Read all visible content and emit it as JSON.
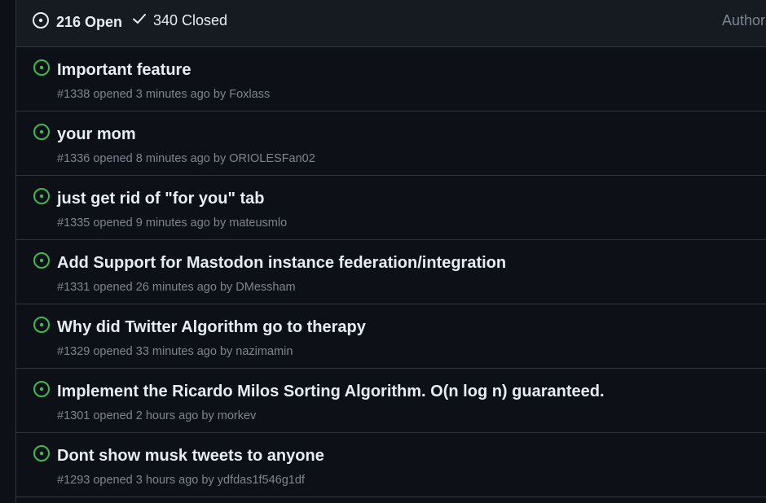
{
  "header": {
    "open_label": "216 Open",
    "closed_label": "340 Closed",
    "author_filter": "Author"
  },
  "colors": {
    "open_icon": "#3fb950",
    "background": "#0d1117",
    "header_bg": "#161b22",
    "muted_text": "#7d8590",
    "border": "#30363d"
  },
  "issues": [
    {
      "title": "Important feature",
      "number": "#1338",
      "opened": "opened 3 minutes ago by",
      "author": "Foxlass"
    },
    {
      "title": "your mom",
      "number": "#1336",
      "opened": "opened 8 minutes ago by",
      "author": "ORIOLESFan02"
    },
    {
      "title": "just get rid of \"for you\" tab",
      "number": "#1335",
      "opened": "opened 9 minutes ago by",
      "author": "mateusmlo"
    },
    {
      "title": "Add Support for Mastodon instance federation/integration",
      "number": "#1331",
      "opened": "opened 26 minutes ago by",
      "author": "DMessham"
    },
    {
      "title": "Why did Twitter Algorithm go to therapy",
      "number": "#1329",
      "opened": "opened 33 minutes ago by",
      "author": "nazimamin"
    },
    {
      "title": "Implement the Ricardo Milos Sorting Algorithm. O(n log n) guaranteed.",
      "number": "#1301",
      "opened": "opened 2 hours ago by",
      "author": "morkev"
    },
    {
      "title": "Dont show musk tweets to anyone",
      "number": "#1293",
      "opened": "opened 3 hours ago by",
      "author": "ydfdas1f546g1df"
    }
  ]
}
